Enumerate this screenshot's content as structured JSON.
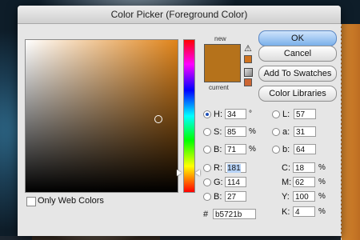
{
  "dialog": {
    "title": "Color Picker (Foreground Color)"
  },
  "preview": {
    "new_label": "new",
    "current_label": "current",
    "current_color": "#b5721b",
    "gamut_warning_icon": "warning-triangle-icon",
    "websafe_icon": "cube-icon",
    "gamut_swatch": "#d0731f",
    "websafe_swatch": "#cc6633"
  },
  "buttons": {
    "ok": "OK",
    "cancel": "Cancel",
    "add_to_swatches": "Add To Swatches",
    "color_libraries": "Color Libraries"
  },
  "hsb": {
    "h": {
      "label": "H:",
      "value": "34",
      "unit": "°"
    },
    "s": {
      "label": "S:",
      "value": "85",
      "unit": "%"
    },
    "b": {
      "label": "B:",
      "value": "71",
      "unit": "%"
    }
  },
  "rgb": {
    "r": {
      "label": "R:",
      "value": "181"
    },
    "g": {
      "label": "G:",
      "value": "114"
    },
    "b": {
      "label": "B:",
      "value": "27"
    }
  },
  "lab": {
    "l": {
      "label": "L:",
      "value": "57"
    },
    "a": {
      "label": "a:",
      "value": "31"
    },
    "b": {
      "label": "b:",
      "value": "64"
    }
  },
  "cmyk": {
    "c": {
      "label": "C:",
      "value": "18",
      "unit": "%"
    },
    "m": {
      "label": "M:",
      "value": "62",
      "unit": "%"
    },
    "y": {
      "label": "Y:",
      "value": "100",
      "unit": "%"
    },
    "k": {
      "label": "K:",
      "value": "4",
      "unit": "%"
    }
  },
  "hex": {
    "label": "#",
    "value": "b5721b"
  },
  "web_colors": {
    "label": "Only Web Colors",
    "checked": false
  },
  "selected_mode": "H"
}
